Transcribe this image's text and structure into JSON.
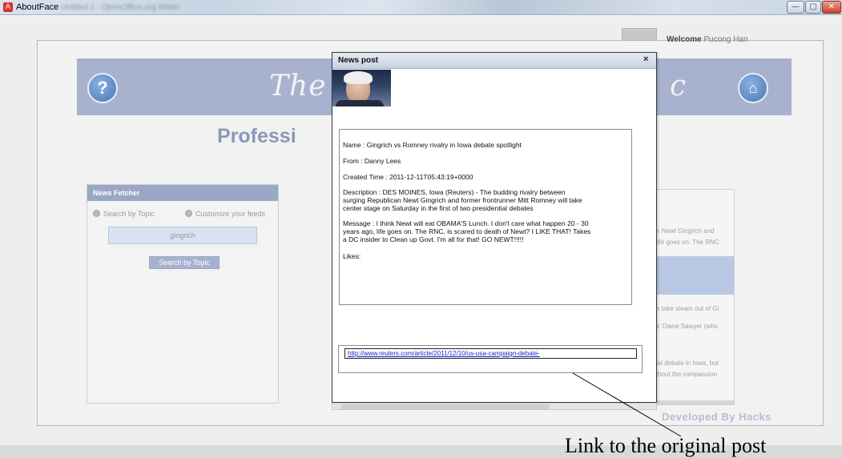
{
  "window": {
    "app_title": "AboutFace",
    "subtitle_blurred": "Untitled 1 - OpenOffice.org Writer",
    "app_icon": "app-logo-icon",
    "controls": {
      "minimize": "—",
      "maximize": "▢",
      "close": "✕"
    }
  },
  "background": {
    "welcome_label": "Welcome",
    "username": "Pucong Han",
    "banner_title": "The F",
    "banner_title_right": "c",
    "subtitle": "Professi",
    "help_icon": "?",
    "home_icon": "⌂",
    "news_fetcher": {
      "heading": "News Fetcher",
      "option_topic": "Search by Topic",
      "option_feeds": "Customize your feeds",
      "input_value": "gingrich",
      "button": "Search by Topic"
    },
    "feed_lines": [
      "n Newt Gingrich and",
      "life goes on. The RNC",
      "n take steam out of Gi",
      "s' Diane Sawyer (who",
      "ial debate in Iowa, but",
      "thout the compassion"
    ],
    "footer": "Developed By Hacks"
  },
  "dialog": {
    "title": "News post",
    "close": "×",
    "name_line": "Name : Gingrich vs Romney rivalry in Iowa debate spotlight",
    "from_line": "From : Danny Lees",
    "created_line": "Created Time : 2011-12-11T05:43:19+0000",
    "description_lines": [
      "Description : DES MOINES, Iowa (Reuters) - The budding rivalry between",
      "surging Republican Newt Gingrich and former frontrunner Mitt Romney will take",
      "center stage on Saturday in the first of two presidential debates"
    ],
    "message_lines": [
      "Message : I think Newt will eat OBAMA'S Lunch. I don't care what happen 20 - 30",
      "years ago, life goes on. The RNC, is scared to death of Newt? I LIKE THAT! Takes",
      "a DC insider to Clean up Govt. I'm all for that! GO NEWT!!!!!"
    ],
    "likes_line": "Likes:",
    "link": "http://www.reuters.com/article/2011/12/10/us-usa-campaign-debate-"
  },
  "annotation": "Link to the original post"
}
